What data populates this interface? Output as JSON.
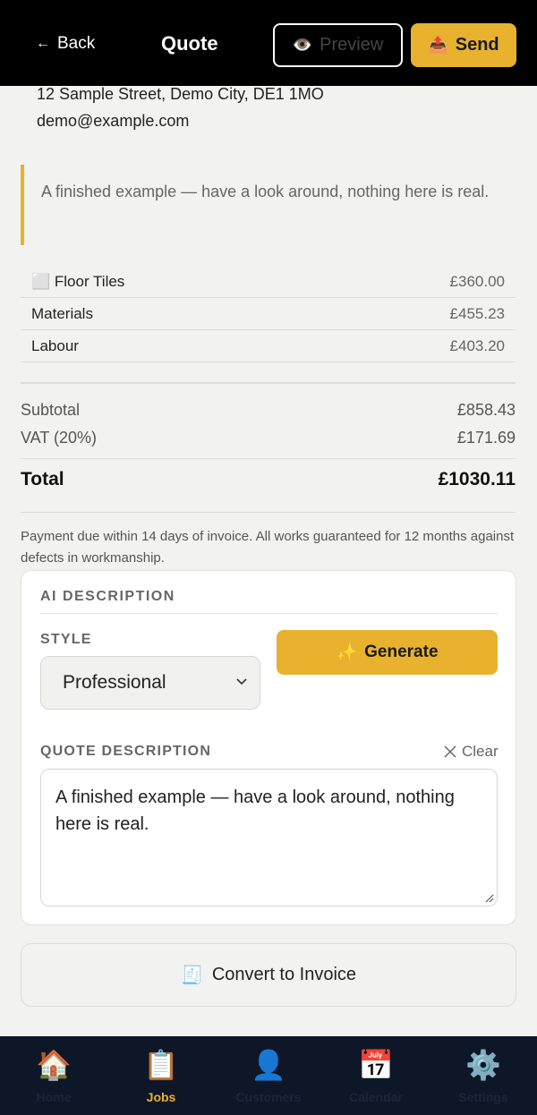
{
  "header": {
    "back_label": "Back",
    "title": "Quote",
    "preview_label": "Preview",
    "send_label": "Send"
  },
  "customer": {
    "address": "12 Sample Street, Demo City, DE1 1MO",
    "email": "demo@example.com"
  },
  "note": "A finished example — have a look around, nothing here is real.",
  "line_items": [
    {
      "name": "⬜ Floor Tiles",
      "price": "£360.00"
    },
    {
      "name": "Materials",
      "price": "£455.23"
    },
    {
      "name": "Labour",
      "price": "£403.20"
    }
  ],
  "totals": {
    "subtotal_label": "Subtotal",
    "subtotal_value": "£858.43",
    "vat_label": "VAT (20%)",
    "vat_value": "£171.69",
    "total_label": "Total",
    "total_value": "£1030.11"
  },
  "terms": "Payment due within 14 days of invoice. All works guaranteed for 12 months against defects in workmanship.",
  "ai": {
    "heading": "AI DESCRIPTION",
    "style_label": "STYLE",
    "style_value": "Professional",
    "generate_label": "Generate",
    "description_label": "QUOTE DESCRIPTION",
    "clear_label": "Clear",
    "description_value": "A finished example — have a look around, nothing here is real."
  },
  "convert_label": "Convert to Invoice",
  "nav": [
    {
      "label": "Home",
      "icon": "🏠",
      "icon_name": "home-icon"
    },
    {
      "label": "Jobs",
      "icon": "📋",
      "icon_name": "clipboard-icon"
    },
    {
      "label": "Customers",
      "icon": "👤",
      "icon_name": "person-icon"
    },
    {
      "label": "Calendar",
      "icon": "📅",
      "icon_name": "calendar-icon"
    },
    {
      "label": "Settings",
      "icon": "⚙️",
      "icon_name": "gear-icon"
    }
  ],
  "colors": {
    "accent": "#e8b22f",
    "header": "#000000",
    "nav": "#0e1728"
  }
}
